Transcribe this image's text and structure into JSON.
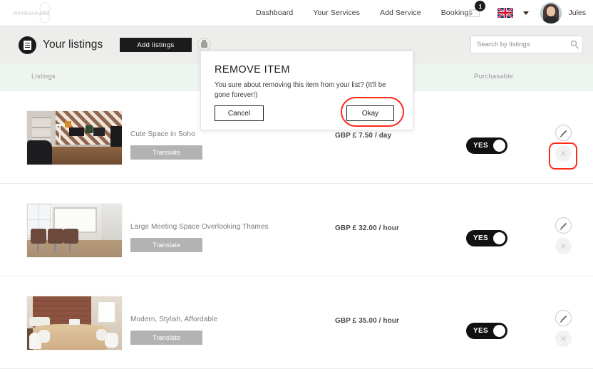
{
  "brand": {
    "logo_text": "workaround"
  },
  "topnav": {
    "links": [
      {
        "label": "Dashboard"
      },
      {
        "label": "Your Services"
      },
      {
        "label": "Add Service"
      },
      {
        "label": "Bookings"
      }
    ],
    "mail_icon": "envelope-icon",
    "mail_badge": "1",
    "flag": "uk-flag-icon",
    "language_chevron": "chevron-down-icon",
    "avatar": "user-avatar",
    "username": "Jules"
  },
  "toolbar": {
    "page_icon": "listings-icon",
    "title": "Your listings",
    "add_button": "Add  listings",
    "circle_action_icon": "archive-icon",
    "search_placeholder": "Search by listings",
    "search_value": "",
    "search_icon": "search-icon"
  },
  "table": {
    "headers": {
      "listings": "Listings",
      "purchasable": "Purchasable"
    },
    "rows": [
      {
        "photo": "patterned-wallpaper-workspace",
        "title": "Cute Space in Soho",
        "translate_label": "Translate",
        "price": "GBP £ 7.50 / day",
        "purchasable": "YES",
        "edit_icon": "pencil-icon",
        "delete_icon": "close-icon"
      },
      {
        "photo": "meeting-room-leather-chairs",
        "title": "Large Meeting Space Overlooking Thames",
        "translate_label": "Translate",
        "price": "GBP £ 32.00 / hour",
        "purchasable": "YES",
        "edit_icon": "pencil-icon",
        "delete_icon": "close-icon"
      },
      {
        "photo": "brick-wall-boardroom",
        "title": "Modern, Stylish, Affordable",
        "translate_label": "Translate",
        "price": "GBP £ 35.00 / hour",
        "purchasable": "YES",
        "edit_icon": "pencil-icon",
        "delete_icon": "close-icon"
      }
    ]
  },
  "modal": {
    "title": "REMOVE ITEM",
    "body": "You sure about removing this item from your list? (It'll be gone forever!)",
    "cancel_label": "Cancel",
    "okay_label": "Okay"
  },
  "colors": {
    "accent_black": "#1b1b1b",
    "annotation_red": "#ff2a1a",
    "toolbar_gray": "#ededeb",
    "table_head_mint": "#eef5f0",
    "translate_gray": "#b3b3b3"
  }
}
